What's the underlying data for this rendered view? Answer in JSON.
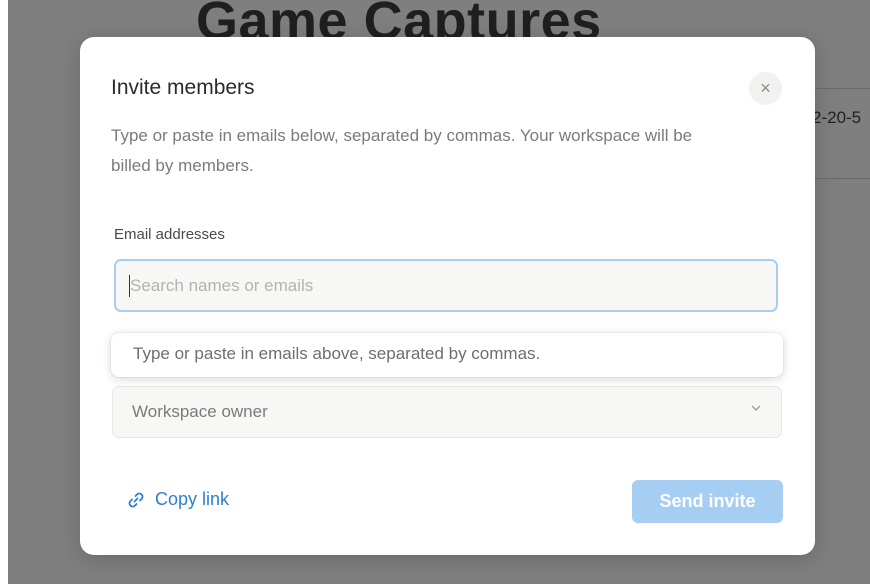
{
  "background": {
    "page_title": "Game Captures",
    "date_fragment": "2-20-5"
  },
  "modal": {
    "title": "Invite members",
    "close_glyph": "×",
    "description": "Type or paste in emails below, separated by commas. Your workspace will be billed by members.",
    "email_label": "Email addresses",
    "email_placeholder": "Search names or emails",
    "email_value": "",
    "hint": "Type or paste in emails above, separated by commas.",
    "role_value": "Workspace owner",
    "copy_link_label": "Copy link",
    "send_label": "Send invite"
  },
  "colors": {
    "accent": "#2e7fd3",
    "send_disabled": "#a6cdf2",
    "input_focus_border": "#a8cdf0"
  },
  "icons": {
    "close": "close-icon",
    "chevron": "chevron-down-icon",
    "link": "link-icon"
  }
}
